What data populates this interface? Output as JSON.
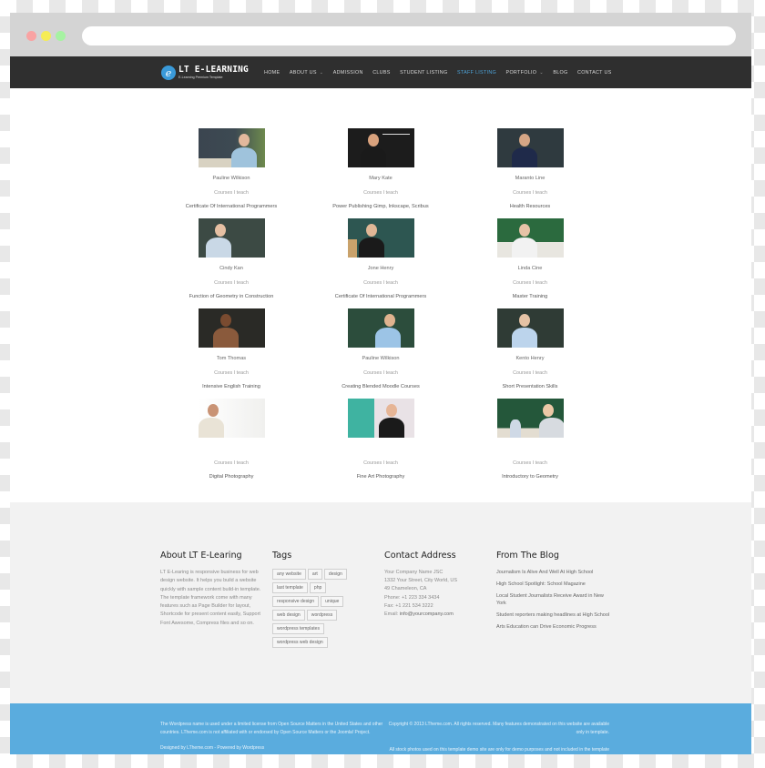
{
  "browser": {
    "window_controls": [
      "close",
      "minimize",
      "maximize"
    ],
    "url": ""
  },
  "header": {
    "logo_title": "LT E-LEARNING",
    "logo_subtitle": "E-Learning Premium Template",
    "logo_icon": "e-letter-circle-icon",
    "accent_color": "#4da3d9",
    "nav": [
      {
        "label": "HOME",
        "has_dropdown": false,
        "active": false
      },
      {
        "label": "ABOUT US",
        "has_dropdown": true,
        "active": false
      },
      {
        "label": "ADMISSION",
        "has_dropdown": false,
        "active": false
      },
      {
        "label": "CLUBS",
        "has_dropdown": false,
        "active": false
      },
      {
        "label": "STUDENT LISTING",
        "has_dropdown": false,
        "active": false
      },
      {
        "label": "STAFF LISTING",
        "has_dropdown": false,
        "active": true
      },
      {
        "label": "PORTFOLIO",
        "has_dropdown": true,
        "active": false
      },
      {
        "label": "BLOG",
        "has_dropdown": false,
        "active": false
      },
      {
        "label": "CONTACT US",
        "has_dropdown": false,
        "active": false
      }
    ]
  },
  "staff": [
    {
      "name": "Pauline Wilkison",
      "courses_label": "Courses I teach",
      "course": "Certificate Of International Programmers",
      "photo": "teacher-with-laptop"
    },
    {
      "name": "Mary Kate",
      "courses_label": "Courses I teach",
      "course": "Power Publishing Gimp, Inkscape, Scribus",
      "photo": "teacher-chalkboard-impossible"
    },
    {
      "name": "Maranto Line",
      "courses_label": "Courses I teach",
      "course": "Health Resources",
      "photo": "teacher-math-board"
    },
    {
      "name": "Cindy Kan",
      "courses_label": "Courses I teach",
      "course": "Function of Geometry in Construction",
      "photo": "teacher-with-pointer"
    },
    {
      "name": "Jone Henry",
      "courses_label": "Courses I teach",
      "course": "Certificate Of International Programmers",
      "photo": "teacher-drawing-diagram"
    },
    {
      "name": "Linda Cine",
      "courses_label": "Courses I teach",
      "course": "Master Training",
      "photo": "teacher-arms-crossed"
    },
    {
      "name": "Tom Thomas",
      "courses_label": "Courses I teach",
      "course": "Intensive English Training",
      "photo": "teacher-math-equations"
    },
    {
      "name": "Pauline Wilkison",
      "courses_label": "Courses I teach",
      "course": "Creating Blended Moodle Courses",
      "photo": "teacher-pointing"
    },
    {
      "name": "Kento Henry",
      "courses_label": "Courses I teach",
      "course": "Short Presentation Skills",
      "photo": "teacher-glasses"
    },
    {
      "name": "",
      "courses_label": "Courses I teach",
      "course": "Digital Photography",
      "photo": "teacher-writing-whiteboard"
    },
    {
      "name": "",
      "courses_label": "Courses I teach",
      "course": "Fine Art Photography",
      "photo": "teacher-teal-board"
    },
    {
      "name": "",
      "courses_label": "Courses I teach",
      "course": "Introductory to Geometry",
      "photo": "teacher-with-child"
    }
  ],
  "footer": {
    "about": {
      "title": "About LT E-Learing",
      "text": "LT E-Learing is responsive business for web design website. It helps you build a website quickly with sample content build-in template. The template framework come with many features such as Page Builder for layout, Shortcode for present content easily, Support Font Awesome, Compress files and so on."
    },
    "tags": {
      "title": "Tags",
      "items": [
        "any website",
        "art",
        "design",
        "last template",
        "php",
        "responsive design",
        "unique",
        "web design",
        "wordpress",
        "wordpress templates",
        "wordpress web design"
      ]
    },
    "contact": {
      "title": "Contact Address",
      "company": "Your Company Name JSC",
      "street": "1332 Your Street, City World, US",
      "city": "49 Chameleon, CA",
      "phone": "Phone: +1 223 334 3434",
      "fax": "Fax: +1 221 534 3222",
      "email_label": "Email: ",
      "email": "info@yourcompany.com"
    },
    "blog": {
      "title": "From The Blog",
      "items": [
        "Journalism Is Alive And Well At High School",
        "High School Spotlight: School Magazine",
        "Local Student Journalists Receive Award in New York",
        "Student reporters making headlines at High School",
        "Arts Education can Drive Economic Progress"
      ]
    },
    "bottom": {
      "background_color": "#5aacde",
      "left_notice": "The Wordpress name is used under a limited license from Open Source Matters in the United States and other countries. LTheme.com is not affiliated with or endorsed by Open Source Matters or the Joomla! Project.",
      "left_notice_2": "Designed by LTheme.com - Powered by Wordpress",
      "copyright": "Copyright © 2013 LTheme.com. All rights reserved. Many features demonstrated on this website are available only in template.",
      "stock_notice": "All stock photos used on this template demo site are only for demo purposes and not included in the template package."
    }
  }
}
